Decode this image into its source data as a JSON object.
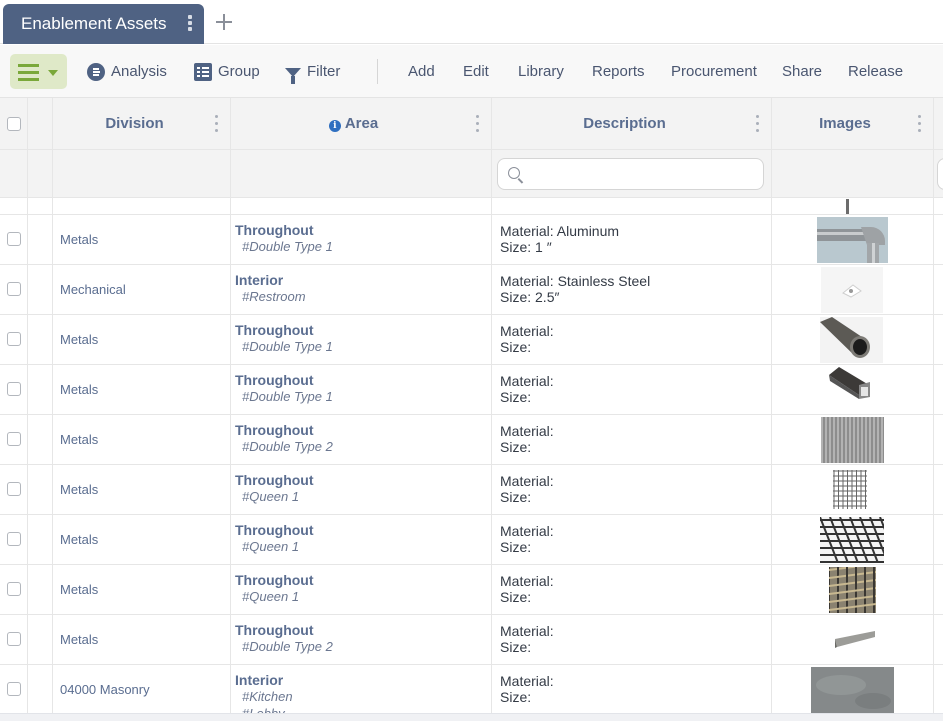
{
  "tabs": [
    {
      "label": "Enablement Assets",
      "active": true
    }
  ],
  "toolbar": {
    "menu_icon": "hamburger-menu-icon",
    "analysis_label": "Analysis",
    "group_label": "Group",
    "filter_label": "Filter",
    "actions": [
      "Add",
      "Edit",
      "Library",
      "Reports",
      "Procurement",
      "Share",
      "Release"
    ]
  },
  "columns": [
    {
      "key": "division",
      "label": "Division"
    },
    {
      "key": "area",
      "label": "Area",
      "icon": "info-icon"
    },
    {
      "key": "description",
      "label": "Description"
    },
    {
      "key": "images",
      "label": "Images"
    }
  ],
  "filters": {
    "description_placeholder": ""
  },
  "rows": [
    {
      "division": "Metals",
      "area": "Throughout",
      "tags": [
        "#Double Type 1"
      ],
      "material": "Material: Aluminum",
      "size": "Size: 1 ″",
      "image": "pipe-elbow"
    },
    {
      "division": "Mechanical",
      "area": "Interior",
      "tags": [
        "#Restroom"
      ],
      "material": "Material: Stainless Steel",
      "size": "Size: 2.5″",
      "image": "floor-drain"
    },
    {
      "division": "Metals",
      "area": "Throughout",
      "tags": [
        "#Double Type 1"
      ],
      "material": "Material:",
      "size": "Size:",
      "image": "round-tube"
    },
    {
      "division": "Metals",
      "area": "Throughout",
      "tags": [
        "#Double Type 1"
      ],
      "material": "Material:",
      "size": "Size:",
      "image": "square-tube"
    },
    {
      "division": "Metals",
      "area": "Throughout",
      "tags": [
        "#Double Type 2"
      ],
      "material": "Material:",
      "size": "Size:",
      "image": "corrugated-sheet"
    },
    {
      "division": "Metals",
      "area": "Throughout",
      "tags": [
        "#Queen 1"
      ],
      "material": "Material:",
      "size": "Size:",
      "image": "wire-mesh"
    },
    {
      "division": "Metals",
      "area": "Throughout",
      "tags": [
        "#Queen 1"
      ],
      "material": "Material:",
      "size": "Size:",
      "image": "rebar-mat"
    },
    {
      "division": "Metals",
      "area": "Throughout",
      "tags": [
        "#Queen 1"
      ],
      "material": "Material:",
      "size": "Size:",
      "image": "rebar-cage"
    },
    {
      "division": "Metals",
      "area": "Throughout",
      "tags": [
        "#Double Type 2"
      ],
      "material": "Material:",
      "size": "Size:",
      "image": "angle-bar"
    },
    {
      "division": "04000 Masonry",
      "area": "Interior",
      "tags": [
        "#Kitchen",
        "#Lobby"
      ],
      "material": "Material:",
      "size": "Size:",
      "image": "concrete-surface"
    }
  ]
}
